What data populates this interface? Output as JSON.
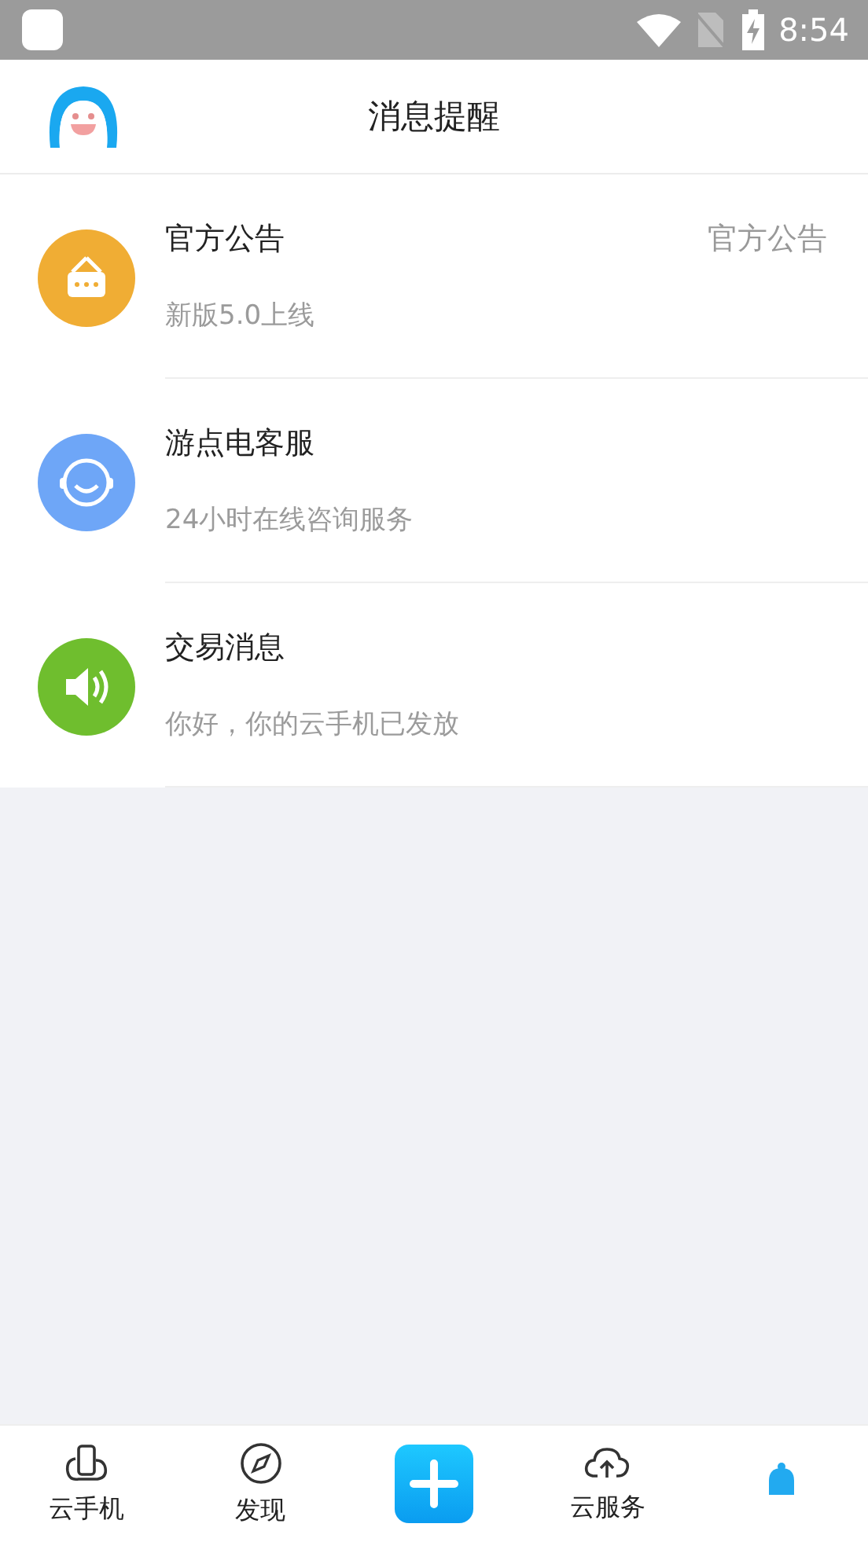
{
  "status_bar": {
    "time": "8:54"
  },
  "header": {
    "title": "消息提醒"
  },
  "messages": [
    {
      "kind": "notice",
      "color": "#f0ad34",
      "title": "官方公告",
      "subtitle": "新版5.0上线",
      "tag": "官方公告"
    },
    {
      "kind": "service",
      "color": "#6ea6f7",
      "title": "游点电客服",
      "subtitle": "24小时在线咨询服务"
    },
    {
      "kind": "trade",
      "color": "#6fbe2e",
      "title": "交易消息",
      "subtitle": "你好，你的云手机已发放"
    }
  ],
  "tabs": [
    {
      "kind": "phone",
      "label": "云手机"
    },
    {
      "kind": "compass",
      "label": "发现"
    },
    {
      "kind": "plus"
    },
    {
      "kind": "cloud",
      "label": "云服务"
    },
    {
      "kind": "bell"
    }
  ]
}
